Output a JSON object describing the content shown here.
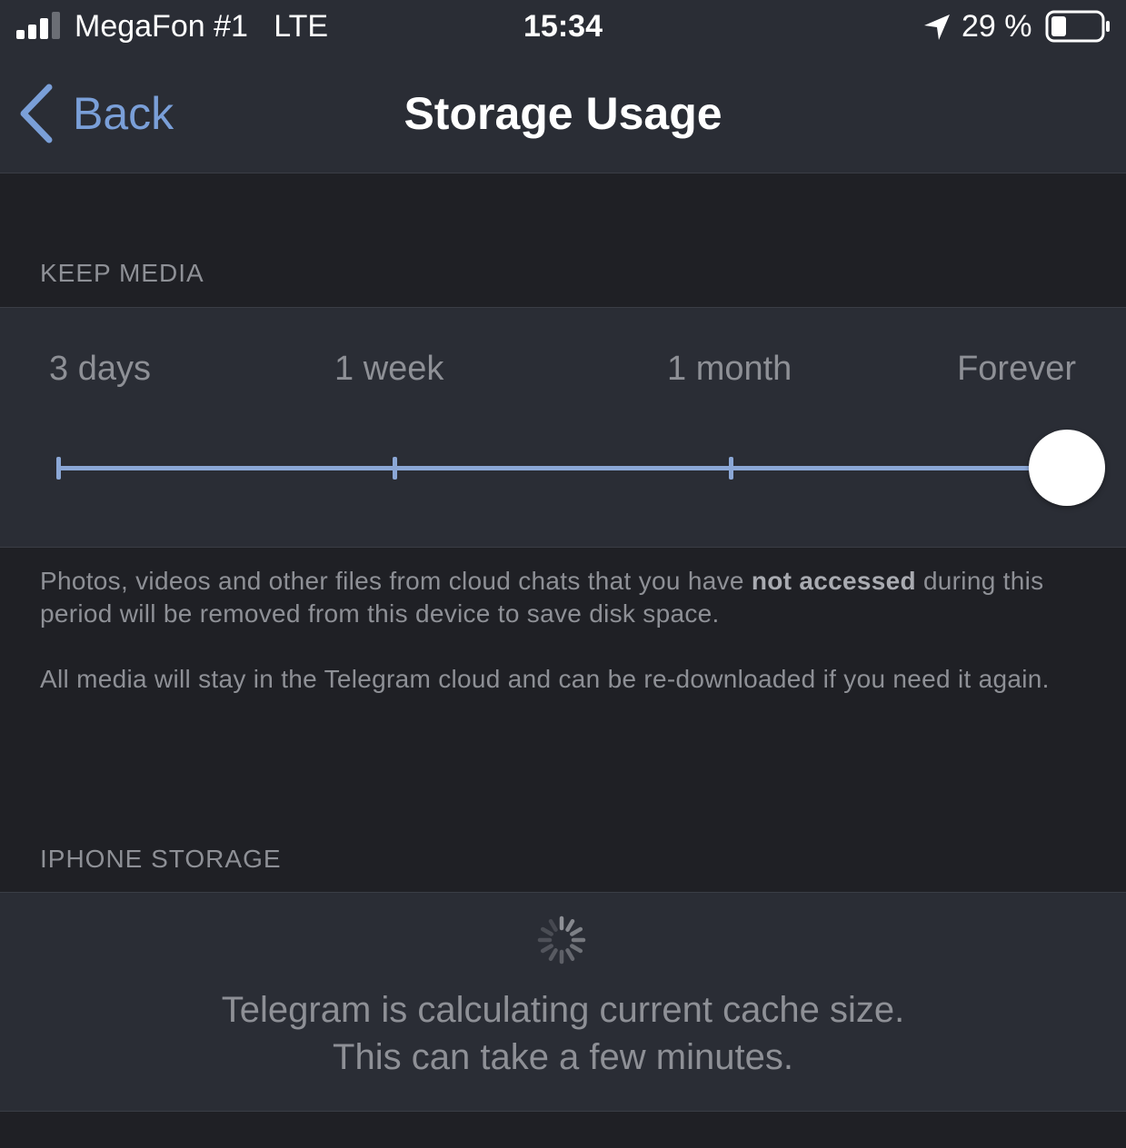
{
  "status_bar": {
    "carrier": "MegaFon #1   LTE",
    "time": "15:34",
    "battery": "29 %",
    "icons": [
      "signal-icon",
      "location-arrow-icon",
      "battery-icon"
    ]
  },
  "nav": {
    "back_label": "Back",
    "title": "Storage Usage",
    "icons": [
      "back-chevron-icon"
    ]
  },
  "keep_media": {
    "header": "KEEP MEDIA",
    "options": [
      "3 days",
      "1 week",
      "1 month",
      "Forever"
    ],
    "selected": "Forever",
    "footer_part1": "Photos, videos and other files from cloud chats that you have ",
    "footer_bold": "not accessed",
    "footer_part2": " during this period will be removed from this device to save disk space.",
    "footer_2": "All media will stay in the Telegram cloud and can be re-downloaded if you need it again."
  },
  "iphone_storage": {
    "header": "IPHONE STORAGE",
    "line1": "Telegram is calculating current cache size.",
    "line2": "This can take a few minutes.",
    "icons": [
      "loading-spinner-icon"
    ]
  },
  "colors": {
    "background": "#1f2025",
    "card": "#2a2d35",
    "accent": "#7a9fd8",
    "slider": "#8ba7d6",
    "secondary_text": "#8e9096"
  }
}
